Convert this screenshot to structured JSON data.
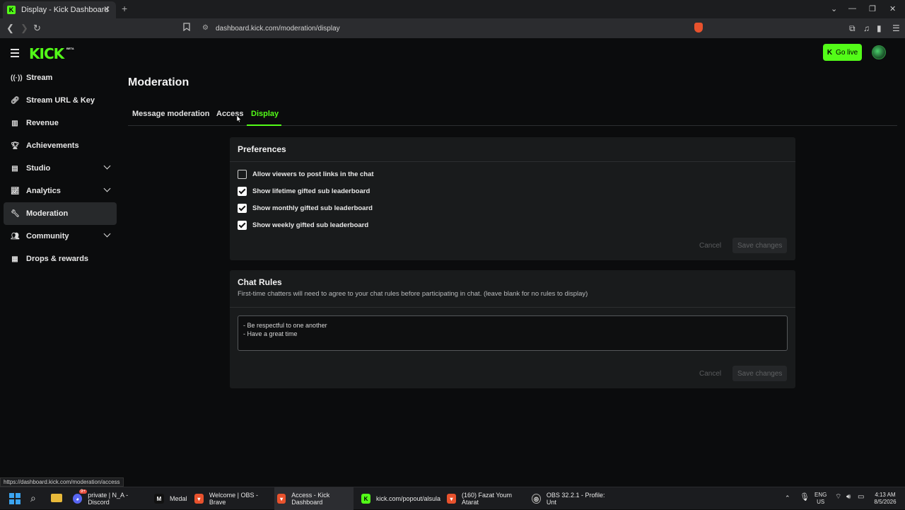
{
  "browser": {
    "tab_title": "Display - Kick Dashboard",
    "url": "dashboard.kick.com/moderation/display",
    "status_url": "https://dashboard.kick.com/moderation/access"
  },
  "header": {
    "logo": "KICK",
    "beta": "BETA",
    "go_live": "Go live"
  },
  "sidebar": {
    "items": [
      {
        "label": "Stream",
        "icon": "broadcast-icon"
      },
      {
        "label": "Stream URL & Key",
        "icon": "link-icon"
      },
      {
        "label": "Revenue",
        "icon": "chart-icon"
      },
      {
        "label": "Achievements",
        "icon": "trophy-icon"
      },
      {
        "label": "Studio",
        "icon": "studio-icon"
      },
      {
        "label": "Analytics",
        "icon": "analytics-icon"
      },
      {
        "label": "Moderation",
        "icon": "wrench-icon"
      },
      {
        "label": "Community",
        "icon": "people-icon"
      },
      {
        "label": "Drops & rewards",
        "icon": "gift-icon"
      }
    ]
  },
  "main": {
    "title": "Moderation",
    "tabs": [
      "Message moderation",
      "Access",
      "Display"
    ],
    "active_tab": "Display"
  },
  "preferences": {
    "title": "Preferences",
    "options": [
      {
        "label": "Allow viewers to post links in the chat",
        "checked": false
      },
      {
        "label": "Show lifetime gifted sub leaderboard",
        "checked": true
      },
      {
        "label": "Show monthly gifted sub leaderboard",
        "checked": true
      },
      {
        "label": "Show weekly gifted sub leaderboard",
        "checked": true
      }
    ],
    "cancel": "Cancel",
    "save": "Save changes"
  },
  "chat_rules": {
    "title": "Chat Rules",
    "description": "First-time chatters will need to agree to your chat rules before participating in chat. (leave blank for no rules to display)",
    "value": "- Be respectful to one another\n- Have a great time",
    "cancel": "Cancel",
    "save": "Save changes"
  },
  "taskbar": {
    "items": [
      {
        "label": "private | N_A - Discord",
        "badge": "9+"
      },
      {
        "label": "Medal"
      },
      {
        "label": "Welcome | OBS - Brave"
      },
      {
        "label": "Access - Kick Dashboard"
      },
      {
        "label": "kick.com/popout/alsula"
      },
      {
        "label": "(160) Fazat Youm Atarat"
      },
      {
        "label": "OBS 32.2.1 - Profile: Unt"
      }
    ],
    "lang": "ENG",
    "region": "US",
    "time": "4:13 AM",
    "date": "8/5/2026"
  },
  "colors": {
    "accent": "#53fc18",
    "background": "#0b0c0d",
    "card": "#191b1c"
  }
}
